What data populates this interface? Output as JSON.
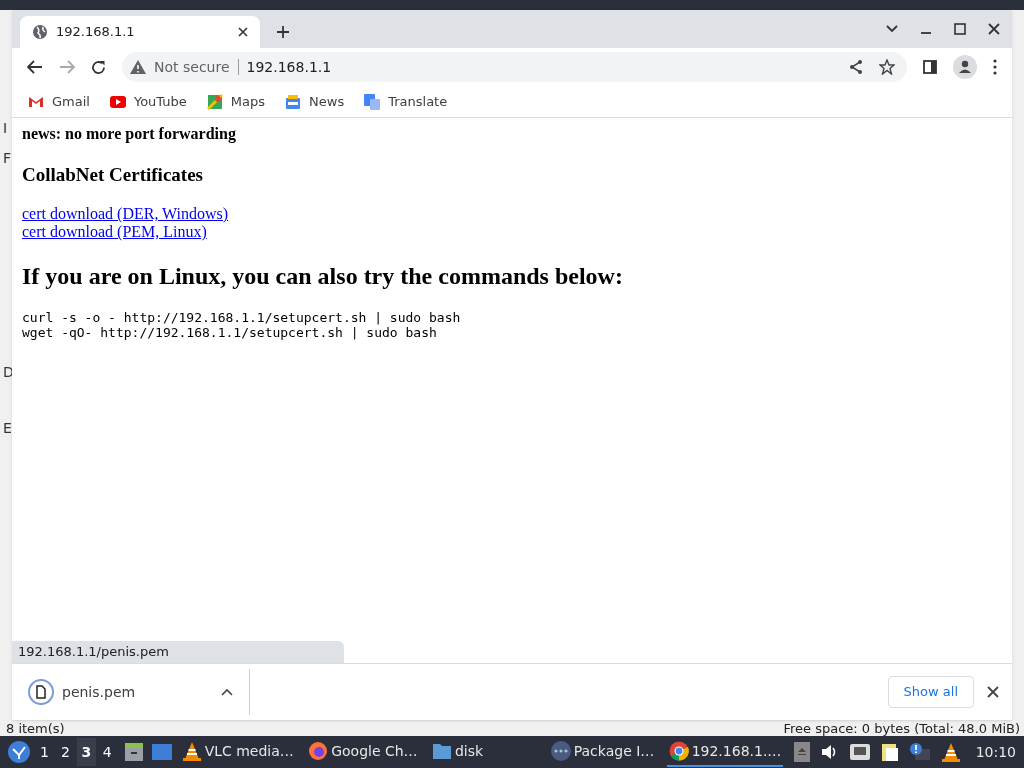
{
  "browser": {
    "tabs": [
      {
        "title": "192.168.1.1",
        "selected": true
      }
    ],
    "address": {
      "security": "Not secure",
      "url": "192.168.1.1"
    },
    "bookmarks": [
      {
        "label": "Gmail",
        "kind": "gmail"
      },
      {
        "label": "YouTube",
        "kind": "youtube"
      },
      {
        "label": "Maps",
        "kind": "maps"
      },
      {
        "label": "News",
        "kind": "news"
      },
      {
        "label": "Translate",
        "kind": "translate"
      }
    ],
    "page": {
      "news": "news: no more port forwarding",
      "heading": "CollabNet Certificates",
      "links": [
        "cert download (DER, Windows)",
        "cert download (PEM, Linux)"
      ],
      "heading2": "If you are on Linux, you can also try the commands below:",
      "commands": [
        "curl -s -o - http://192.168.1.1/setupcert.sh | sudo bash",
        "wget -qO- http://192.168.1.1/setupcert.sh | sudo bash"
      ]
    },
    "status_url": "192.168.1.1/penis.pem",
    "downloads": [
      {
        "filename": "penis.pem"
      }
    ],
    "show_all": "Show all"
  },
  "background_window": {
    "edge_letters": [
      "I",
      "F",
      "D",
      "E"
    ],
    "status_left": "8 item(s)",
    "status_right": "Free space: 0 bytes (Total: 48.0 MiB)"
  },
  "taskbar": {
    "workspaces": [
      {
        "label": "1",
        "selected": false
      },
      {
        "label": "2",
        "selected": false
      },
      {
        "label": "3",
        "selected": true
      },
      {
        "label": "4",
        "selected": false
      }
    ],
    "tasks": [
      {
        "label": "VLC media…",
        "kind": "vlc",
        "selected": false
      },
      {
        "label": "Google Ch…",
        "kind": "firefox",
        "selected": false
      },
      {
        "label": "disk",
        "kind": "folder",
        "selected": false
      },
      {
        "label": "Package I…",
        "kind": "dots",
        "selected": false
      },
      {
        "label": "192.168.1.…",
        "kind": "chrome",
        "selected": true
      }
    ],
    "clock": "10:10"
  }
}
